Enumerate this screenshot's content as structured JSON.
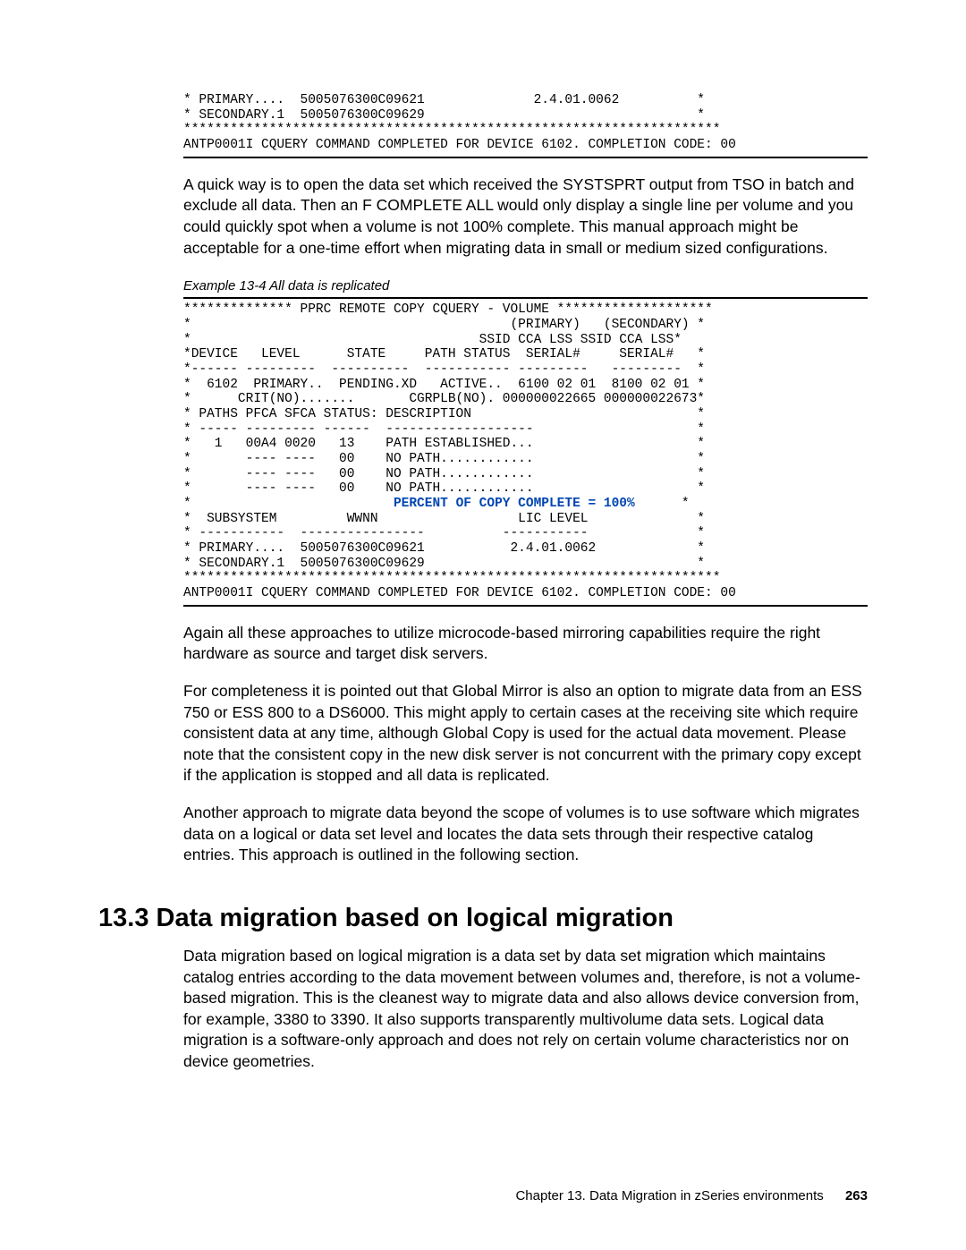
{
  "code1": {
    "line1": "* PRIMARY....  5005076300C09621              2.4.01.0062          *",
    "line2": "* SECONDARY.1  5005076300C09629                                   *",
    "line3": "*********************************************************************",
    "line4": "ANTP0001I CQUERY COMMAND COMPLETED FOR DEVICE 6102. COMPLETION CODE: 00"
  },
  "para1": "A quick way is to open the data set which received the SYSTSPRT output from TSO in batch and exclude all data. Then an F COMPLETE ALL would only display a single line per volume and you could quickly spot when a volume is not 100% complete. This manual approach might be acceptable for a one-time effort when migrating data in small or medium sized configurations.",
  "example_caption": "Example 13-4   All data is replicated",
  "code2": {
    "l1": "************** PPRC REMOTE COPY CQUERY - VOLUME ********************",
    "l2": "*                                         (PRIMARY)   (SECONDARY) *",
    "l3": "*                                     SSID CCA LSS SSID CCA LSS*",
    "l4": "*DEVICE   LEVEL      STATE     PATH STATUS  SERIAL#     SERIAL#   *",
    "l5": "*------ ---------  ----------  ----------- ---------   ---------  *",
    "l6": "*  6102  PRIMARY..  PENDING.XD   ACTIVE..  6100 02 01  8100 02 01 *",
    "l7": "*      CRIT(NO).......       CGRPLB(NO). 000000022665 000000022673*",
    "l8": "* PATHS PFCA SFCA STATUS: DESCRIPTION                             *",
    "l9": "* ----- --------- ------  -------------------                     *",
    "l10": "*   1   00A4 0020   13    PATH ESTABLISHED...                     *",
    "l11": "*       ---- ----   00    NO PATH............                     *",
    "l12": "*       ---- ----   00    NO PATH............                     *",
    "l13": "*       ---- ----   00    NO PATH............                     *",
    "l14_pre": "*                          ",
    "l14_hi": "PERCENT OF COPY COMPLETE = 100%",
    "l14_post": "      *",
    "l15": "*  SUBSYSTEM         WWNN                  LIC LEVEL              *",
    "l16": "* -----------  ----------------          -----------              *",
    "l17": "* PRIMARY....  5005076300C09621           2.4.01.0062             *",
    "l18": "* SECONDARY.1  5005076300C09629                                   *",
    "l19": "*********************************************************************",
    "l20": "ANTP0001I CQUERY COMMAND COMPLETED FOR DEVICE 6102. COMPLETION CODE: 00"
  },
  "para2": "Again all these approaches to utilize microcode-based mirroring capabilities require the right hardware as source and target disk servers.",
  "para3": "For completeness it is pointed out that Global Mirror is also an option to migrate data from an ESS 750 or ESS 800 to a DS6000. This might apply to certain cases at the receiving site which require consistent data at any time, although Global Copy is used for the actual data movement. Please note that the consistent copy in the new disk server is not concurrent with the primary copy except if the application is stopped and all data is replicated.",
  "para4": "Another approach to migrate data beyond the scope of volumes is to use software which migrates data on a logical or data set level and locates the data sets through their respective catalog entries. This approach is outlined in the following section.",
  "heading": "13.3  Data migration based on logical migration",
  "para5": "Data migration based on logical migration is a data set by data set migration which maintains catalog entries according to the data movement between volumes and, therefore, is not a volume-based migration. This is the cleanest way to migrate data and also allows device conversion from, for example, 3380 to 3390. It also supports transparently multivolume data sets. Logical data migration is a software-only approach and does not rely on certain volume characteristics nor on device geometries.",
  "footer_chapter": "Chapter 13. Data Migration in zSeries environments",
  "footer_page": "263"
}
